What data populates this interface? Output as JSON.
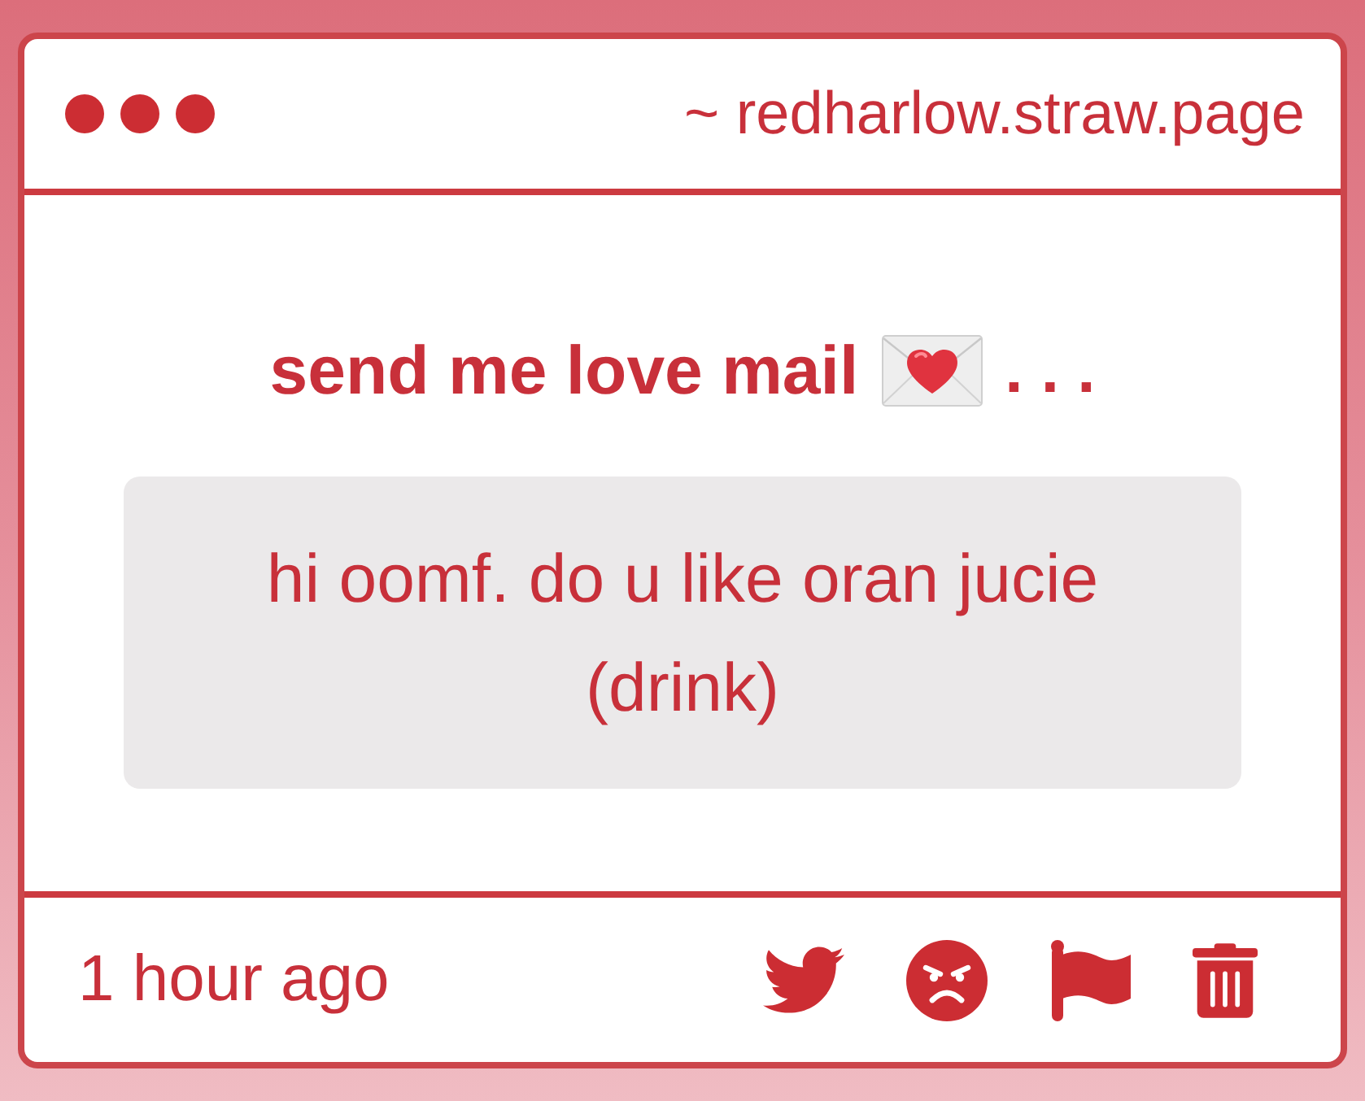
{
  "window": {
    "address": "~ redharlow.straw.page"
  },
  "prompt": {
    "text": "send me love mail",
    "trail": ". . ."
  },
  "message": {
    "text": "hi oomf. do u like oran jucie (drink)"
  },
  "footer": {
    "time": "1 hour ago"
  }
}
